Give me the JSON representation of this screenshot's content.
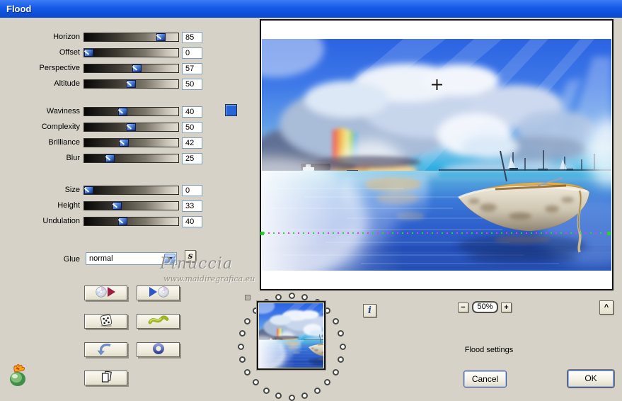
{
  "window": {
    "title": "Flood"
  },
  "sliders": {
    "groups": [
      {
        "items": [
          {
            "label": "Horizon",
            "value": 85
          },
          {
            "label": "Offset",
            "value": 0
          },
          {
            "label": "Perspective",
            "value": 57
          },
          {
            "label": "Altitude",
            "value": 50
          }
        ]
      },
      {
        "items": [
          {
            "label": "Waviness",
            "value": 40
          },
          {
            "label": "Complexity",
            "value": 50
          },
          {
            "label": "Brilliance",
            "value": 42
          },
          {
            "label": "Blur",
            "value": 25
          }
        ]
      },
      {
        "items": [
          {
            "label": "Size",
            "value": 0
          },
          {
            "label": "Height",
            "value": 33
          },
          {
            "label": "Undulation",
            "value": 40
          }
        ]
      }
    ]
  },
  "color_swatch": {
    "color": "#2565d8"
  },
  "glue": {
    "label": "Glue",
    "selected": "normal",
    "script_button": "s"
  },
  "tool_buttons": [
    {
      "icon": "cd-open-icon"
    },
    {
      "icon": "cd-save-icon"
    },
    {
      "icon": "dice-icon"
    },
    {
      "icon": "wave-icon"
    },
    {
      "icon": "undo-icon"
    },
    {
      "icon": "ring-icon"
    },
    {
      "icon": "copy-icon"
    }
  ],
  "watermark": {
    "name": "Pinuccia",
    "site": "www.maidiregrafica.eu"
  },
  "preview": {
    "zoom_out": "−",
    "zoom_level": "50%",
    "zoom_in": "+",
    "info": "i",
    "scroll_up": "^"
  },
  "status_text": "Flood settings",
  "actions": {
    "cancel": "Cancel",
    "ok": "OK"
  }
}
